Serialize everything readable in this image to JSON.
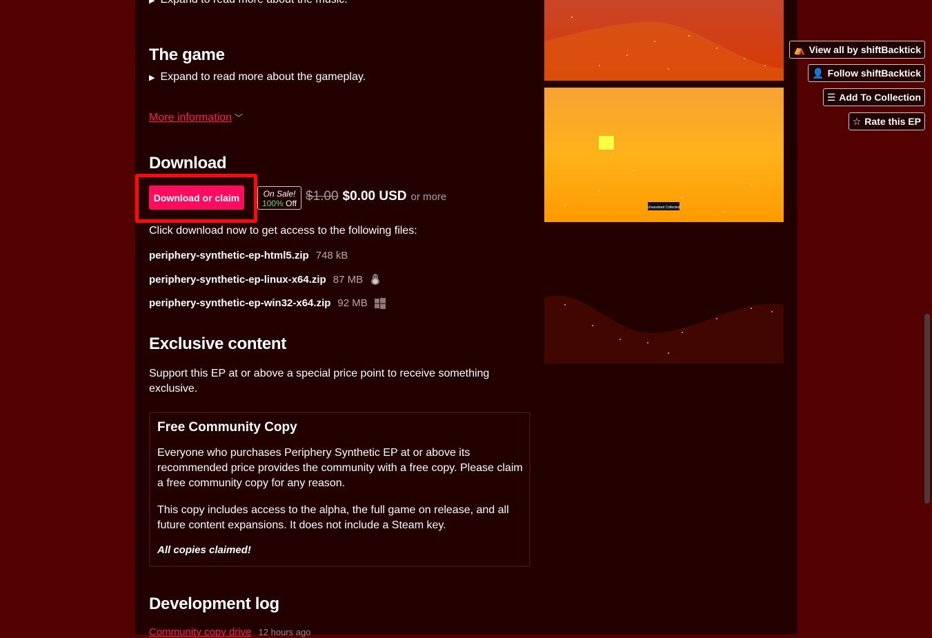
{
  "top_expand": "Expand to read more about the music.",
  "game": {
    "heading": "The game",
    "expand": "Expand to read more about the gameplay."
  },
  "more_info": {
    "label": "More information",
    "chevron": "chevron-down-icon"
  },
  "download": {
    "heading": "Download",
    "button_label": "Download or claim",
    "sale_label": "On Sale!",
    "sale_percent": "100%",
    "sale_off": "Off",
    "original_price": "$1.00",
    "price": "$0.00 USD",
    "or_more": "or more",
    "intro": "Click download now to get access to the following files:",
    "files": [
      {
        "name": "periphery-synthetic-ep-html5.zip",
        "size": "748 kB",
        "platform_icon": ""
      },
      {
        "name": "periphery-synthetic-ep-linux-x64.zip",
        "size": "87 MB",
        "platform_icon": "linux-icon"
      },
      {
        "name": "periphery-synthetic-ep-win32-x64.zip",
        "size": "92 MB",
        "platform_icon": "windows-icon"
      }
    ]
  },
  "exclusive": {
    "heading": "Exclusive content",
    "intro": "Support this EP at or above a special price point to receive something exclusive.",
    "reward": {
      "title": "Free Community Copy",
      "p1": "Everyone who purchases Periphery Synthetic EP at or above its recommended price provides the community with a free copy. Please claim a free community copy for any reason.",
      "p2": "This copy includes access to the alpha, the full game on release, and all future content expansions. It does not include a Steam key.",
      "status": "All copies claimed!"
    }
  },
  "devlog": {
    "heading": "Development log",
    "first_post": "Community copy drive",
    "first_post_time": "12 hours ago"
  },
  "screenshot_caption": "Unassisted Collected",
  "sidebar": {
    "view_all": "View all by shiftBacktick",
    "follow": "Follow shiftBacktick",
    "add_collection": "Add To Collection",
    "rate": "Rate this EP"
  },
  "colors": {
    "page_bg": "#230000",
    "outer_bg": "#520000",
    "accent": "#ff0c5e",
    "link": "#ff1760",
    "sale_green": "#4ee36f",
    "highlight": "#ff0a0a"
  }
}
